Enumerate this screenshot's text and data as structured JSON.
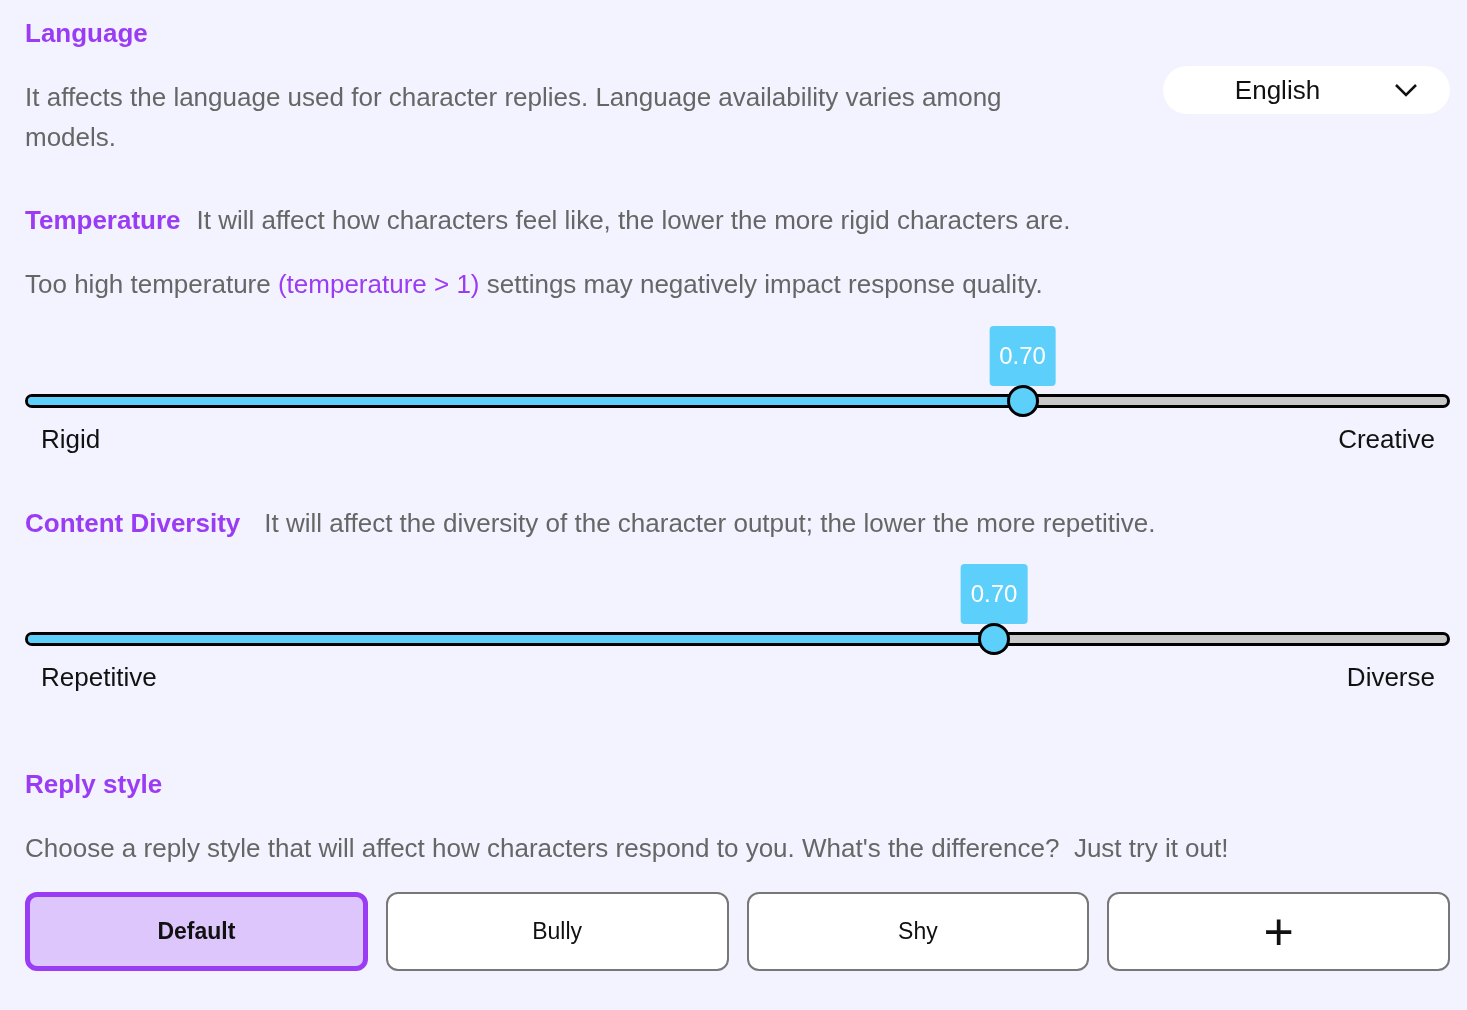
{
  "language": {
    "title": "Language",
    "description": "It affects the language used for character replies. Language availability varies among models.",
    "dropdown": {
      "value": "English"
    }
  },
  "temperature": {
    "title": "Temperature",
    "description": "It will affect how characters feel like, the lower the more rigid characters are.",
    "warning_before": "Too high temperature",
    "warning_highlight": "(temperature > 1)",
    "warning_after": "settings may negatively impact response quality.",
    "slider": {
      "value_label": "0.70",
      "level": 0.7,
      "min_label": "Rigid",
      "max_label": "Creative"
    }
  },
  "content_diversity": {
    "title": "Content Diversity",
    "description": "It will affect the diversity of the character output; the lower the more repetitive.",
    "slider": {
      "value_label": "0.70",
      "level": 0.68,
      "min_label": "Repetitive",
      "max_label": "Diverse"
    }
  },
  "reply_style": {
    "title": "Reply style",
    "description": "Choose a reply style that will affect how characters respond to you. What's the difference?  Just try it out!",
    "options": [
      {
        "kind": "text",
        "label": "Default",
        "selected": true
      },
      {
        "kind": "text",
        "label": "Bully",
        "selected": false
      },
      {
        "kind": "text",
        "label": "Shy",
        "selected": false
      },
      {
        "kind": "add",
        "label": "+",
        "selected": false
      }
    ]
  }
}
